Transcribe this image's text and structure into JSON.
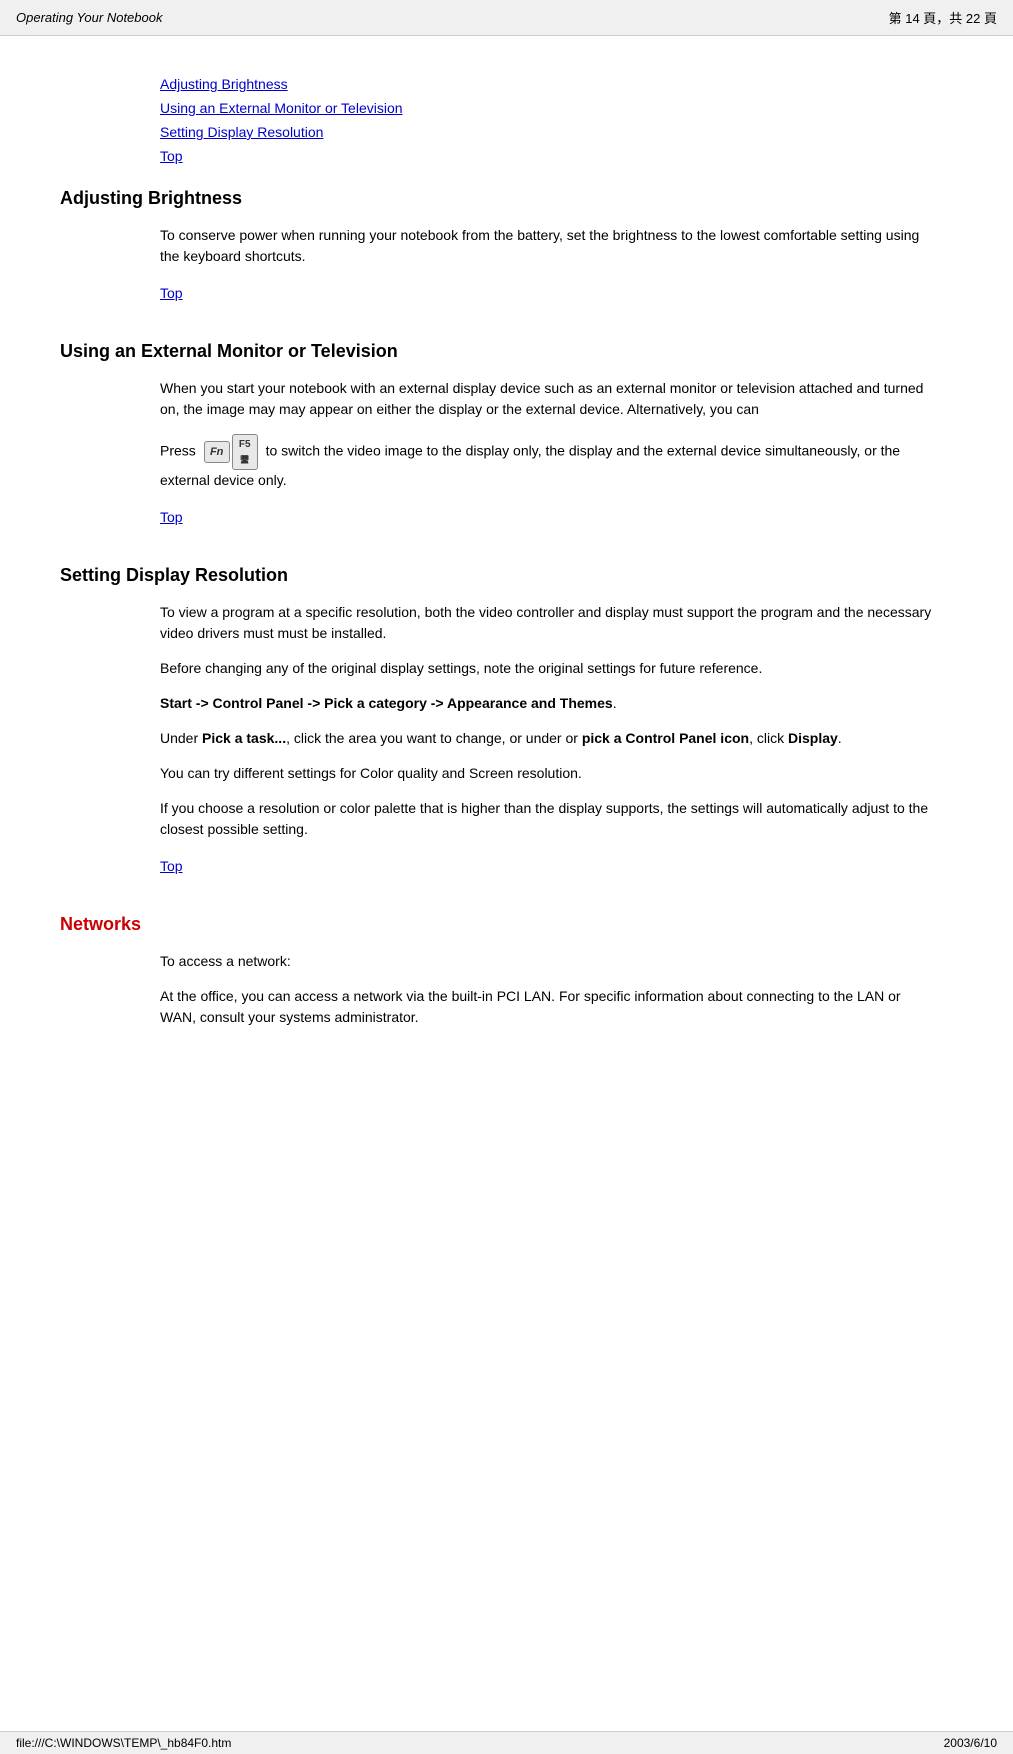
{
  "header": {
    "title": "Operating Your Notebook",
    "page_info": "第 14 頁，共 22 頁"
  },
  "footer": {
    "url": "file:///C:\\WINDOWS\\TEMP\\_hb84F0.htm",
    "date": "2003/6/10"
  },
  "toc": {
    "links": [
      "Adjusting Brightness",
      "Using an External Monitor or Television",
      "Setting Display Resolution",
      "Top"
    ]
  },
  "sections": [
    {
      "id": "adjusting-brightness",
      "heading": "Adjusting Brightness",
      "color": "black",
      "paragraphs": [
        "To conserve power when running your notebook from the battery, set the brightness to the lowest comfortable setting using the keyboard shortcuts."
      ],
      "top_link": "Top"
    },
    {
      "id": "external-monitor",
      "heading": "Using an External Monitor or Television",
      "color": "black",
      "paragraphs": [
        "When you start your notebook with an external display device such as an external monitor or television attached and turned on, the image may may appear on either the display or the external device. Alternatively, you can"
      ],
      "press_text_before": "Press ",
      "press_keys": [
        "Fn",
        "F5"
      ],
      "press_text_after": " to switch the video image to the display only, the display and the external device simultaneously, or the external device only.",
      "top_link": "Top"
    },
    {
      "id": "display-resolution",
      "heading": "Setting Display Resolution",
      "color": "black",
      "paragraphs": [
        "To view a program at a specific resolution, both the video controller and display must support the program and the necessary video drivers must must be installed.",
        "Before changing any of the original display settings, note the original settings for future reference."
      ],
      "bold_paragraph": {
        "text": "Start -> Control Panel -> Pick a category -> Appearance and Themes",
        "suffix": "."
      },
      "mixed_paragraphs": [
        {
          "prefix": "Under ",
          "bold": "Pick a task...",
          "middle": ", click the area you want to change, or under or ",
          "bold2": "pick a Control Panel icon",
          "suffix": ", click ",
          "bold3": "Display",
          "end": "."
        }
      ],
      "plain_paragraphs": [
        "You can try different settings for Color quality and Screen resolution.",
        "If you choose a resolution or color palette that is higher than the display supports, the settings will automatically adjust to the closest possible setting."
      ],
      "top_link": "Top"
    },
    {
      "id": "networks",
      "heading": "Networks",
      "color": "red",
      "paragraphs": [
        "To access a network:",
        "At the office, you can access a network via the built-in PCI LAN. For specific information about connecting to the LAN or WAN, consult your systems administrator."
      ]
    }
  ]
}
